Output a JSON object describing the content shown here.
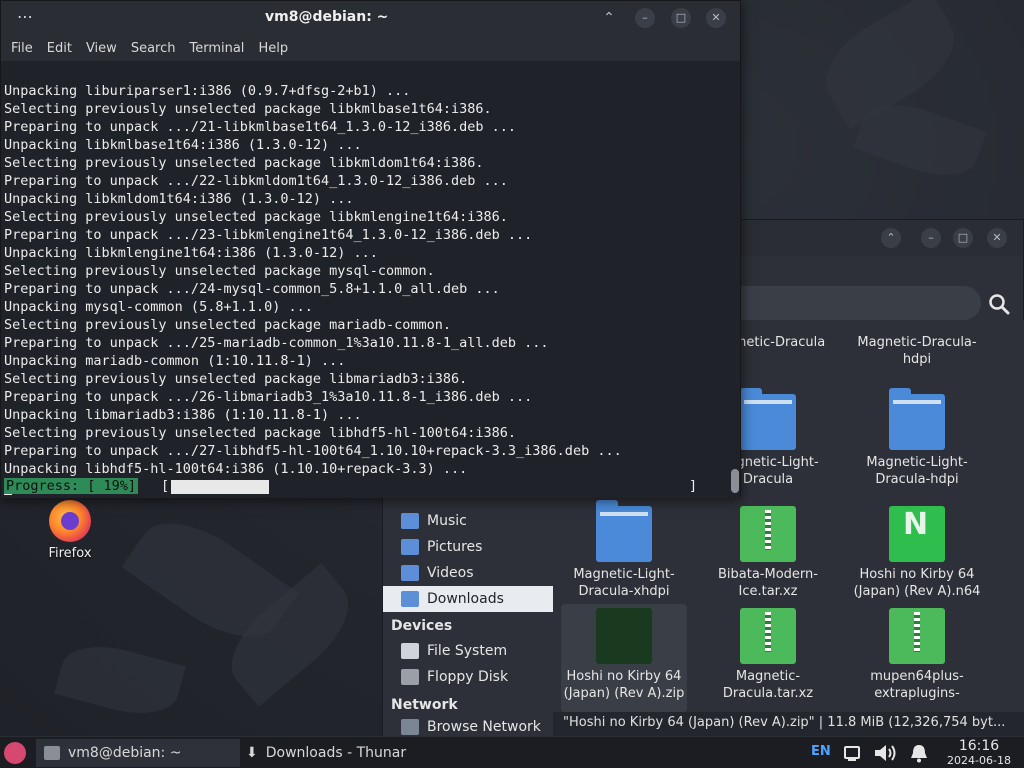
{
  "terminal": {
    "title": "vm8@debian: ~",
    "menu": [
      "File",
      "Edit",
      "View",
      "Search",
      "Terminal",
      "Help"
    ],
    "lines": [
      "Unpacking liburiparser1:i386 (0.9.7+dfsg-2+b1) ...",
      "Selecting previously unselected package libkmlbase1t64:i386.",
      "Preparing to unpack .../21-libkmlbase1t64_1.3.0-12_i386.deb ...",
      "Unpacking libkmlbase1t64:i386 (1.3.0-12) ...",
      "Selecting previously unselected package libkmldom1t64:i386.",
      "Preparing to unpack .../22-libkmldom1t64_1.3.0-12_i386.deb ...",
      "Unpacking libkmldom1t64:i386 (1.3.0-12) ...",
      "Selecting previously unselected package libkmlengine1t64:i386.",
      "Preparing to unpack .../23-libkmlengine1t64_1.3.0-12_i386.deb ...",
      "Unpacking libkmlengine1t64:i386 (1.3.0-12) ...",
      "Selecting previously unselected package mysql-common.",
      "Preparing to unpack .../24-mysql-common_5.8+1.1.0_all.deb ...",
      "Unpacking mysql-common (5.8+1.1.0) ...",
      "Selecting previously unselected package mariadb-common.",
      "Preparing to unpack .../25-mariadb-common_1%3a10.11.8-1_all.deb ...",
      "Unpacking mariadb-common (1:10.11.8-1) ...",
      "Selecting previously unselected package libmariadb3:i386.",
      "Preparing to unpack .../26-libmariadb3_1%3a10.11.8-1_i386.deb ...",
      "Unpacking libmariadb3:i386 (1:10.11.8-1) ...",
      "Selecting previously unselected package libhdf5-hl-100t64:i386.",
      "Preparing to unpack .../27-libhdf5-hl-100t64_1.10.10+repack-3.3_i386.deb ...",
      "Unpacking libhdf5-hl-100t64:i386 (1.10.10+repack-3.3) ..."
    ],
    "progress_label": "Progress: [ 19%]",
    "progress_bracket_open": "[",
    "progress_bracket_close": "]",
    "progress_fraction": 0.19
  },
  "desktop": {
    "icons": [
      {
        "label": "Firefox",
        "icon": "firefox-icon"
      }
    ]
  },
  "thunar": {
    "title": "Downloads - Thunar",
    "sidebar": {
      "places": [
        {
          "label": "Music",
          "icon": "music-folder-icon"
        },
        {
          "label": "Pictures",
          "icon": "pictures-folder-icon"
        },
        {
          "label": "Videos",
          "icon": "videos-folder-icon"
        },
        {
          "label": "Downloads",
          "icon": "downloads-folder-icon",
          "active": true
        }
      ],
      "devices_heading": "Devices",
      "devices": [
        {
          "label": "File System",
          "icon": "drive-icon"
        },
        {
          "label": "Floppy Disk",
          "icon": "floppy-icon"
        }
      ],
      "network_heading": "Network",
      "network": [
        {
          "label": "Browse Network",
          "icon": "network-icon"
        }
      ]
    },
    "files": [
      {
        "label": "Magnetic-Dracula",
        "type": "folder"
      },
      {
        "label": "Magnetic-Dracula-hdpi",
        "type": "folder"
      },
      {
        "label": "Magnetic-Light-Dracula",
        "type": "folder"
      },
      {
        "label": "Magnetic-Light-Dracula-hdpi",
        "type": "folder"
      },
      {
        "label": "Magnetic-Light-Dracula-xhdpi",
        "type": "folder"
      },
      {
        "label": "Bibata-Modern-Ice.tar.xz",
        "type": "archive"
      },
      {
        "label": "Hoshi no Kirby 64 (Japan) (Rev A).n64",
        "type": "n64"
      },
      {
        "label": "Hoshi no Kirby 64 (Japan) (Rev A).zip",
        "type": "archive-dark",
        "selected": true
      },
      {
        "label": "Magnetic-Dracula.tar.xz",
        "type": "archive"
      },
      {
        "label": "mupen64plus-extraplugins-",
        "type": "archive"
      }
    ],
    "status": "\"Hoshi no Kirby 64 (Japan) (Rev A).zip\"  |  11.8 MiB (12,326,754 byt..."
  },
  "taskbar": {
    "tasks": [
      {
        "label": "vm8@debian: ~",
        "active": true
      },
      {
        "label": "Downloads - Thunar",
        "active": false
      }
    ],
    "lang": "EN",
    "time": "16:16",
    "date": "2024-06-18"
  },
  "colors": {
    "progress_green": "#2e8b57",
    "accent_blue": "#4a8ad8",
    "archive_green": "#4cba5b"
  }
}
